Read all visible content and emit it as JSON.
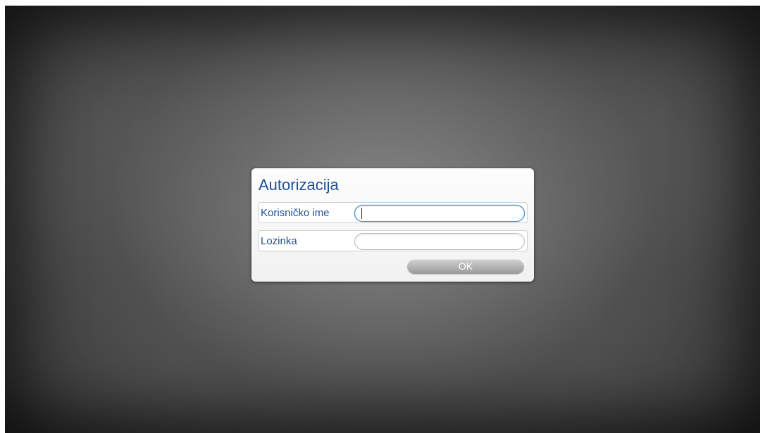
{
  "dialog": {
    "title": "Autorizacija",
    "username_label": "Korisničko ime",
    "username_value": "",
    "password_label": "Lozinka",
    "password_value": "",
    "ok_label": "OK"
  },
  "colors": {
    "title_text": "#1f4f96",
    "focused_border": "#3a8fd6",
    "button_gray": "#9a9a9a",
    "dialog_background": "#f7f7f7"
  }
}
